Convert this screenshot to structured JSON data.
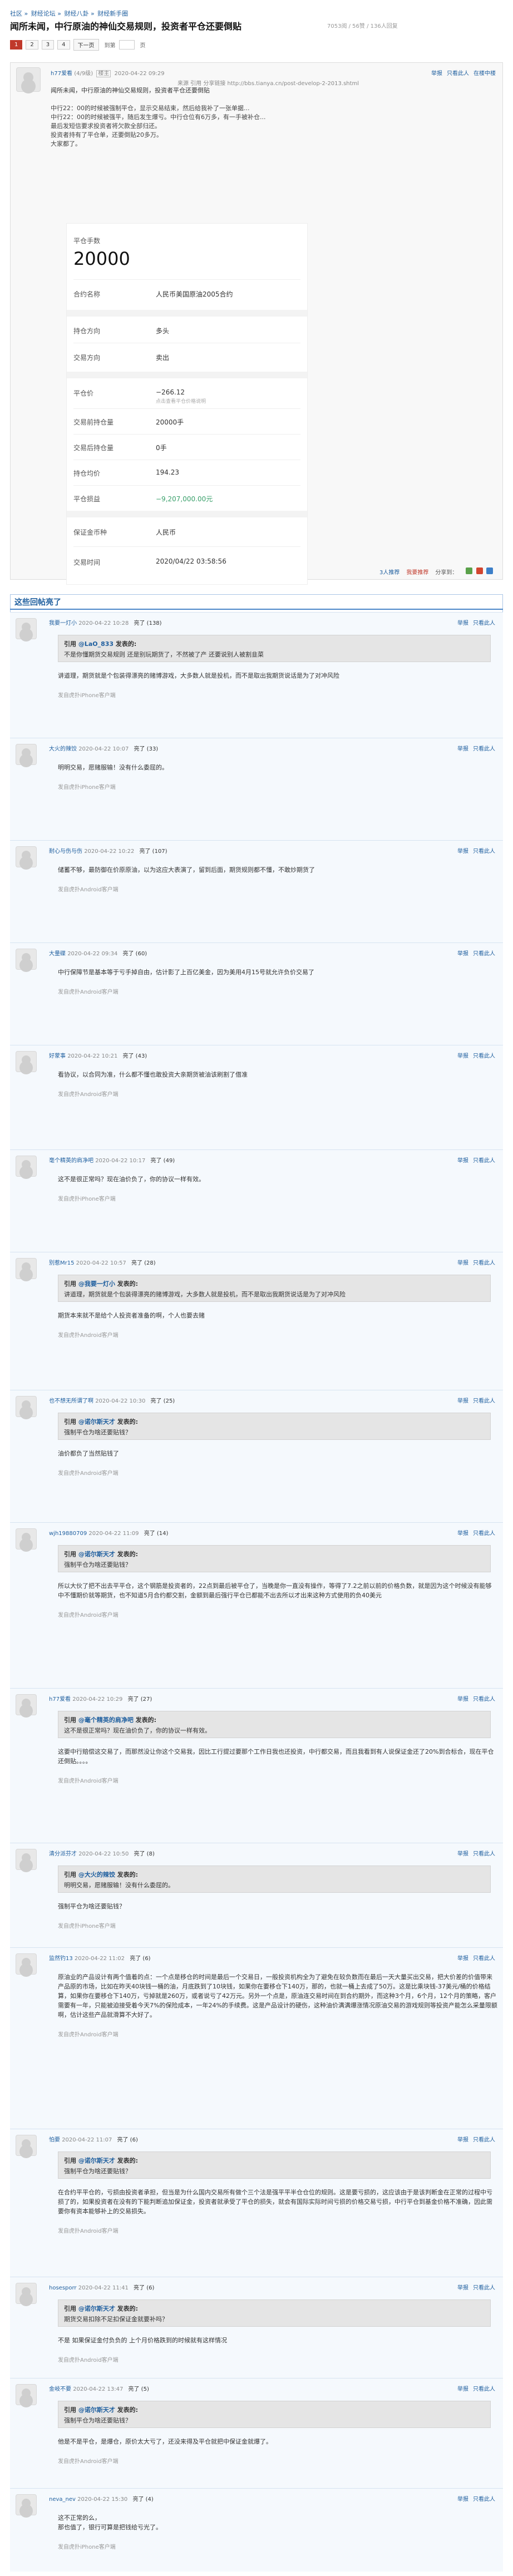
{
  "breadcrumb": [
    "社区",
    "财经论坛",
    "财经八卦",
    "财经新手圈"
  ],
  "title": "闻所未闻，中行原油的神仙交易规则，投资者平仓还要倒贴",
  "title_meta": "7053阅 / 56赞 / 136人回复",
  "pager": {
    "pages": [
      "1",
      "2",
      "3",
      "4"
    ],
    "next": "下一页",
    "jump": "到第",
    "page_unit": "页"
  },
  "op": {
    "user": "h77爱看",
    "level": "(4/9级)",
    "badge": "楼主",
    "time": "2020-04-22 09:29",
    "link_text": "来源 引用 分享链接 http://bbs.tianya.cn/post-develop-2-2013.shtml",
    "tools": [
      "举报",
      "只看此人",
      "在楼中楼"
    ],
    "lines": [
      "闻所未闻，中行原油的神仙交易规则，投资者平仓还要倒贴",
      "中行22：00的时候被强制平仓，显示交易结束，然后给我补了一张单据...",
      "中行22：00的时候被强平，随后发生爆亏。中行仓位有6万多，有一手被补仓...",
      "最后发短信要求投资者将欠款全部归还。",
      "投资者持有了平仓单，还要倒贴20多万。",
      "大家都了。"
    ],
    "card": {
      "label_lots": "平仓手数",
      "lots": "20000",
      "contract_k": "合约名称",
      "contract_v": "人民币美国原油2005合约",
      "direction_k": "持仓方向",
      "direction_v": "多头",
      "trade_k": "交易方向",
      "trade_v": "卖出",
      "price_k": "平仓价",
      "price_v": "−266.12",
      "price_note": "点击查看平仓价格说明",
      "before_k": "交易前持仓量",
      "before_v": "20000手",
      "after_k": "交易后持仓量",
      "after_v": "0手",
      "avg_k": "持仓均价",
      "avg_v": "194.23",
      "pnl_k": "平仓损益",
      "pnl_v": "−9,207,000.00元",
      "cur_k": "保证金币种",
      "cur_v": "人民币",
      "time_k": "交易时间",
      "time_v": "2020/04/22 03:58:56"
    },
    "bottom": {
      "good": "3人推荐",
      "bad": "我要推荐",
      "share": "分享到："
    }
  },
  "replies_title": "这些回帖亮了",
  "replies": [
    {
      "user": "我要一灯小",
      "time": "2020-04-22 10:28",
      "likes": "亮了 (138)",
      "quote_user": "@LaO_833",
      "quote_text": "不是你懂期货交易规则 还是别玩期货了，不然被了产 还要说别人被割韭菜",
      "text": "讲道理，期货就是个包装得漂亮的赌博游戏，大多数人就是投机，而不是取出我期货说话是为了对冲风险",
      "src": "发自虎扑iPhone客户端"
    },
    {
      "user": "大火的辣饺",
      "time": "2020-04-22 10:07",
      "likes": "亮了 (33)",
      "quote_user": "",
      "quote_text": "",
      "text": "明明交易，愿赌服输！没有什么委屈的。",
      "src": "发自虎扑iPhone客户端"
    },
    {
      "user": "耐心与伤与伤",
      "time": "2020-04-22 10:22",
      "likes": "亮了 (107)",
      "quote_user": "",
      "quote_text": "",
      "text": "储蓄不够，最防御在价原原油，以为这应大表演了，留到后面，期货规则都不懂，不敢炒期货了",
      "src": "发自虎扑Android客户端"
    },
    {
      "user": "大量碟",
      "time": "2020-04-22 09:34",
      "likes": "亮了 (60)",
      "quote_user": "",
      "quote_text": "",
      "text": "中行保障节是基本等于亏手掉自由，估计影了上百亿美金，因为美用4月15号就允许负价交易了",
      "src": "发自虎扑Android客户端"
    },
    {
      "user": "好蒙事",
      "time": "2020-04-22 10:21",
      "likes": "亮了 (43)",
      "quote_user": "",
      "quote_text": "",
      "text": "看协议，以合同为准，什么都不懂也敢投资大亲期货被油该刷割了借准",
      "src": "发自虎扑Android客户端"
    },
    {
      "user": "毫个精英的肩净吧",
      "time": "2020-04-22 10:17",
      "likes": "亮了 (49)",
      "quote_user": "",
      "quote_text": "",
      "text": "这不是很正常吗？现在油价负了，你的协议一样有效。",
      "src": "发自虎扑iPhone客户端"
    },
    {
      "user": "别惹Mr15",
      "time": "2020-04-22 10:57",
      "likes": "亮了 (28)",
      "quote_user": "@我要一灯小",
      "quote_text": "讲道理，期货就是个包装得漂亮的赌博游戏，大多数人就是投机，而不是取出我期货说话是为了对冲风险",
      "text": "期货本来就不是给个人投资者准备的啊，个人也要去赌",
      "src": "发自虎扑Android客户端"
    },
    {
      "user": "也不想无所谓了啊",
      "time": "2020-04-22 10:30",
      "likes": "亮了 (25)",
      "quote_user": "@诺尔斯天才",
      "quote_text": "强制平仓为啥还要贴钱？",
      "text": "油价都负了当然贴钱了",
      "src": "发自虎扑Android客户端"
    },
    {
      "user": "wjh19880709",
      "time": "2020-04-22 11:09",
      "likes": "亮了 (14)",
      "quote_user": "@诺尔斯天才",
      "quote_text": "强制平仓为啥还要贴钱？",
      "text": "所以大伙了把不出去平平仓，这个钢筋是投资者的，22点到最后被平仓了，当晚是你一直没有操作，等得了7.2之前以前的价格负数，就是因为这个时候没有能够中不懂期价就等期货，也不知道5月合约都交割，金额到最后强行平仓已都能不出去所以才出来这种方式使用的负40美元",
      "src": "发自虎扑Android客户端"
    },
    {
      "user": "h77爱看",
      "time": "2020-04-22 10:29",
      "likes": "亮了 (27)",
      "quote_user": "@毫个精英的肩净吧",
      "quote_text": "这不是很正常吗？现在油价负了，你的协议一样有效。",
      "text": "这要中行赔偿这交易了，而那然没让你这个交易我，因比工行提过要那个工作日我也还投资，中行都交易，而且我看到有人说保证金还了20%到合标合，现在平仓还倒贴。。。。",
      "src": "发自虎扑Android客户端"
    },
    {
      "user": "清分派芬才",
      "time": "2020-04-22 10:50",
      "likes": "亮了 (8)",
      "quote_user": "@大火的辣饺",
      "quote_text": "明明交易，愿赌服输！没有什么委屈的。",
      "text": "强制平仓为啥还要贴钱？",
      "src": "发自虎扑iPhone客户端"
    },
    {
      "user": "监然钓13",
      "time": "2020-04-22 11:02",
      "likes": "亮了 (6)",
      "quote_user": "",
      "quote_text": "",
      "text": "原油业的产品设计有两个值着的点：一个点是移仓的时间是最后一个交易日，一般投资机构全为了避免在较负数而在最后一天大量买出交易，把大价差的价值带来产品原的市场，比如在昨天40块钱一桶的油，月底跌到了10块钱，如果你在要移仓下140万，那的，也就一桶上去成了50万。这是比乘块钱-37美元/桶的价格结算，如果你在要移仓下140万，亏掉就是260万，或者说亏了42万元。另外一个点是，原油连交易时间在到合约期外，而这种3个月，6个月，12个月的策略，客户需要有一年，只能被迫接受着今天7%的保险成本，一年24%的手续费。这是产品设计的硬伤，这种油价满满爆涨情况原油交易的游戏规则等投资产能怎么采量限额啊，估计这些产品就滑算不大好了。",
      "src": "发自虎扑Android客户端"
    },
    {
      "user": "怕要",
      "time": "2020-04-22 11:07",
      "likes": "亮了 (6)",
      "quote_user": "@诺尔斯天才",
      "quote_text": "强制平仓为啥还要贴钱？",
      "text": "在合约平平仓的，亏损由投资者承担，但当是为什么国内交易所有做个三个法是强平平半仓仓位的规则。这是要亏损的，这应该由于是该判断金在正常的过程中亏损了的，如果投资者在没有的下能判断追加保证金，投资者就承受了平仓的损失，就会有国际实际时间亏损的价格交易亏损，中行平仓到基金价格不准确，因此需要你有资本能够补上的交易损失。",
      "src": "发自虎扑Android客户端"
    },
    {
      "user": "hosesporr",
      "time": "2020-04-22 11:41",
      "likes": "亮了 (6)",
      "quote_user": "@诺尔斯天才",
      "quote_text": "期货交易扣除不足扣保证金就要补吗？",
      "text": "不是 如果保证金付负负的 上个月价格跌到的时候就有这样情况",
      "src": "发自虎扑Android客户端"
    },
    {
      "user": "金岐不要",
      "time": "2020-04-22 13:47",
      "likes": "亮了 (5)",
      "quote_user": "@诺尔斯天才",
      "quote_text": "强制平仓为啥还要贴钱？",
      "text": "他是不是平仓，是爆仓，原价太大亏了，还没来得及平仓就把中保证金就爆了。",
      "src": "发自虎扑Android客户端"
    },
    {
      "user": "neva_nev",
      "time": "2020-04-22 15:30",
      "likes": "亮了 (4)",
      "quote_user": "",
      "quote_text": "",
      "text": "这不正常的么，\n那也值了，银行可算是把钱给亏光了。",
      "src": "发自虎扑iPhone客户端"
    }
  ],
  "reply_tools": [
    "举报",
    "只看此人"
  ]
}
